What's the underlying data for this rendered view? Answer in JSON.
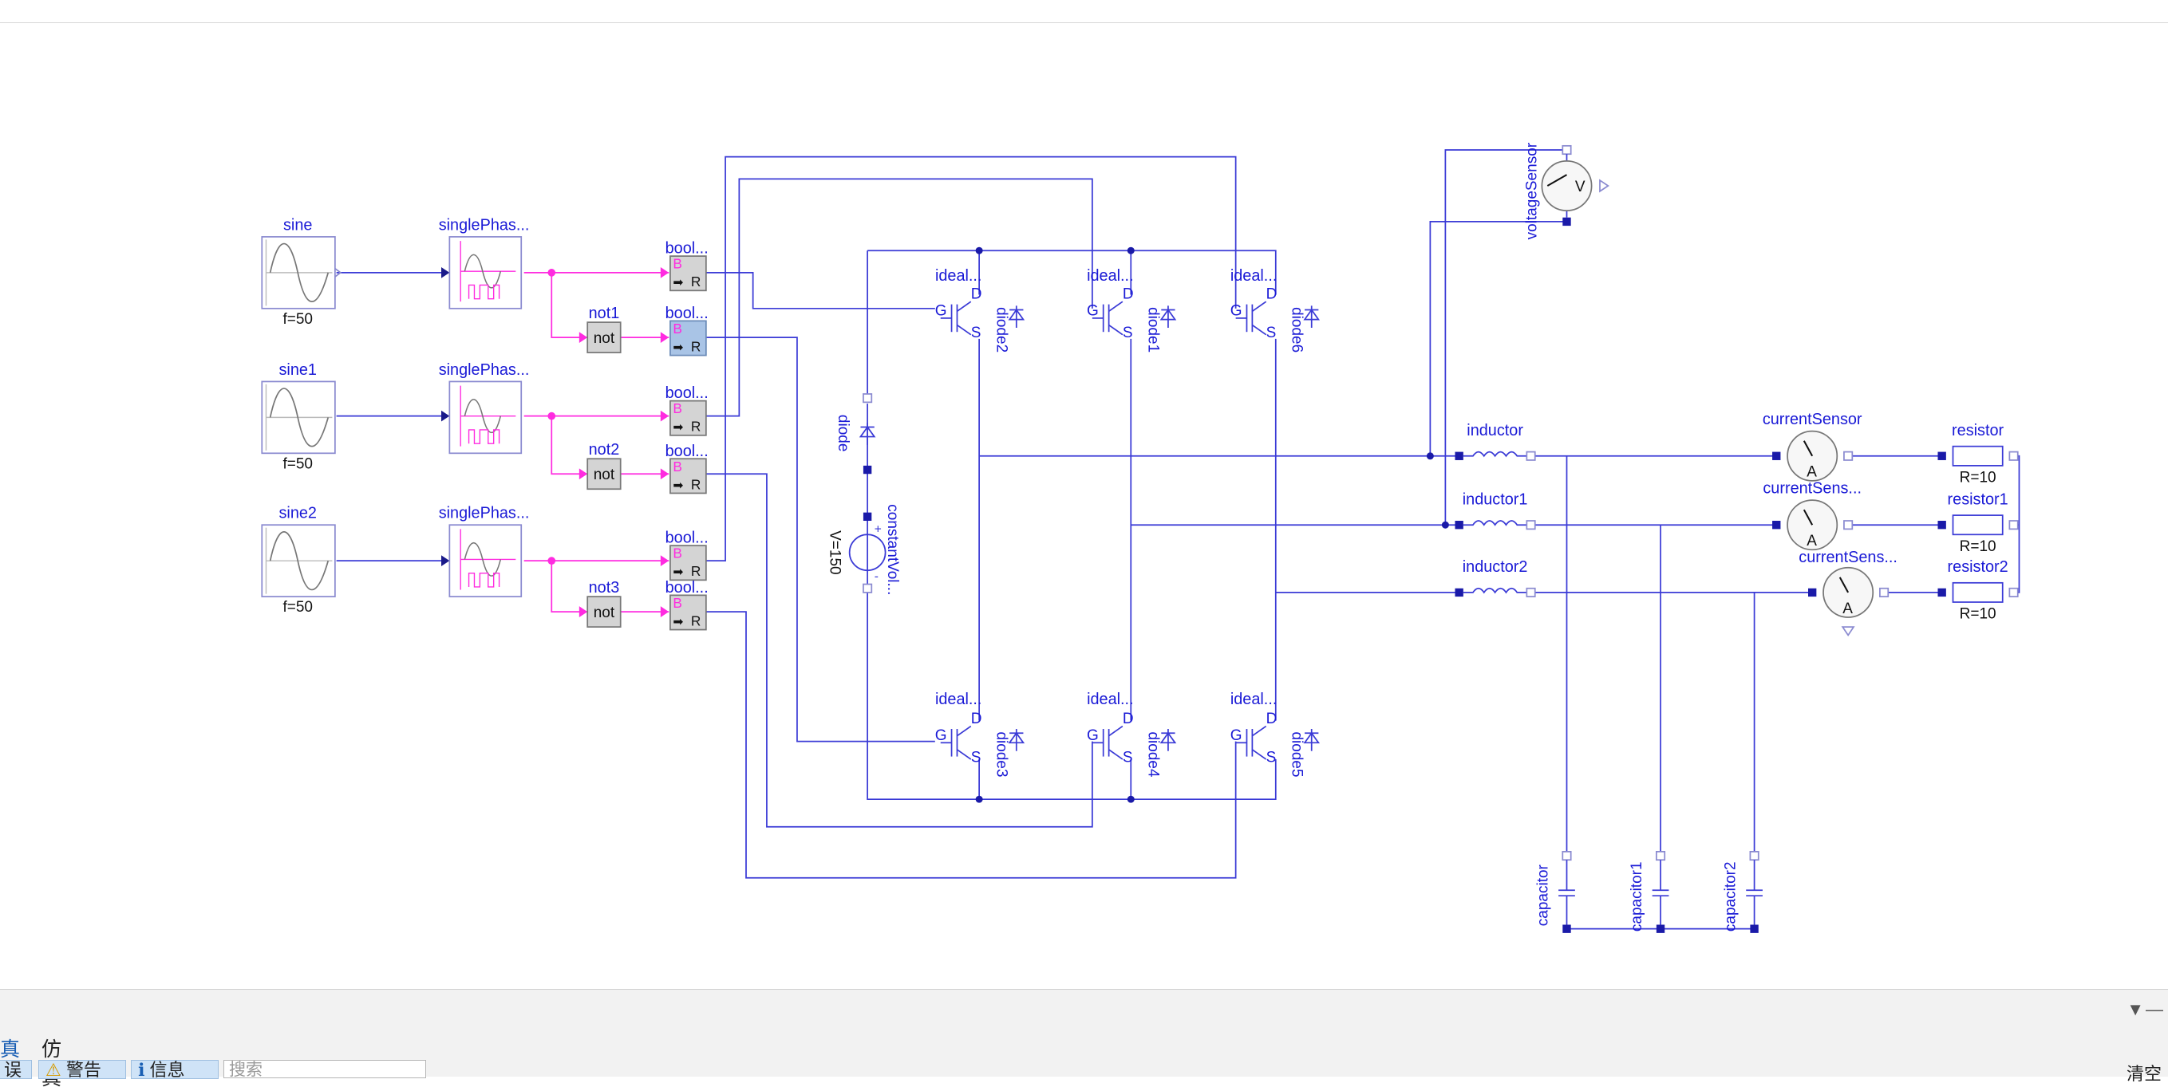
{
  "diagram": {
    "sources": [
      {
        "name": "sine",
        "param": "f=50"
      },
      {
        "name": "sine1",
        "param": "f=50"
      },
      {
        "name": "sine2",
        "param": "f=50"
      }
    ],
    "pwm": [
      "singlePhas...",
      "singlePhas...",
      "singlePhas..."
    ],
    "nots": [
      {
        "name": "not1",
        "text": "not"
      },
      {
        "name": "not2",
        "text": "not"
      },
      {
        "name": "not3",
        "text": "not"
      }
    ],
    "bool_label": "bool...",
    "bool_b": "B",
    "bool_r": "R",
    "switch_label": "ideal...",
    "pin_g": "G",
    "pin_d": "D",
    "pin_s": "S",
    "diodes": [
      "diode2",
      "diode1",
      "diode6",
      "diode3",
      "diode4",
      "diode5"
    ],
    "dc_diode": "diode",
    "dc_source": {
      "name": "constantVol...",
      "param": "V=150"
    },
    "voltage_sensor": {
      "name": "voltageSensor",
      "symbol": "V"
    },
    "inductors": [
      "inductor",
      "inductor1",
      "inductor2"
    ],
    "current_sensors": [
      {
        "name": "currentSensor",
        "symbol": "A"
      },
      {
        "name": "currentSens...",
        "symbol": "A"
      },
      {
        "name": "currentSens...",
        "symbol": "A"
      }
    ],
    "resistors": [
      {
        "name": "resistor",
        "param": "R=10"
      },
      {
        "name": "resistor1",
        "param": "R=10"
      },
      {
        "name": "resistor2",
        "param": "R=10"
      }
    ],
    "capacitors": [
      "capacitor",
      "capacitor1",
      "capacitor2"
    ]
  },
  "bottom_panel": {
    "tabs": [
      "真",
      "仿真"
    ],
    "filters": [
      "误",
      "警告",
      "信息"
    ],
    "search_placeholder": "搜索",
    "clear_label": "清空"
  },
  "colors": {
    "wire": "#3a3ad6",
    "boolean": "#ff2be0",
    "block_border": "#8a8ad0"
  }
}
